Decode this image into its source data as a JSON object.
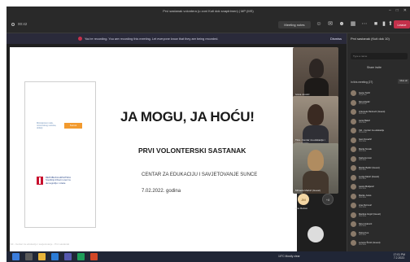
{
  "window": {
    "title": "Prvi sastanak volontera (u zoni Kuti dok snaptrimen) | MP (MS)"
  },
  "toolbar": {
    "timer": "00:42",
    "meeting_notes": "Meeting notes",
    "icons": [
      {
        "name": "people-icon",
        "label": "People"
      },
      {
        "name": "chat-icon",
        "label": "Chat"
      },
      {
        "name": "reactions-icon",
        "label": "React"
      },
      {
        "name": "rooms-icon",
        "label": "Rooms"
      },
      {
        "name": "more-icon",
        "label": "More"
      },
      {
        "name": "camera-icon",
        "label": "Camera"
      },
      {
        "name": "mic-icon",
        "label": "Mic"
      },
      {
        "name": "share-icon",
        "label": "Share"
      }
    ],
    "leave_label": "Leave"
  },
  "banner": {
    "text": "You're recording. You are recording this meeting. Let everyone know that they are being recorded.",
    "dismiss": "Dismiss"
  },
  "slide": {
    "logo_top_text": "Ministarstvo rada, mirovinskog sustava, obitelji",
    "logo_top_org": "Suncé",
    "logo_bottom_text": "REPUBLIKA HRVATSKA Središnji državni ured za demografiju i mlade",
    "title": "JA MOGU, JA HOĆU!",
    "subtitle": "PRVI VOLONTERSKI SASTANAK",
    "org": "CENTAR ZA EDUKACIJU I SAVJETOVANJE SUNCE",
    "date": "7.02.2022. godina",
    "caption": "Vid - Centar za edukaciju i savjetovanje - Prvi sastanak"
  },
  "tiles": [
    {
      "name": "Ivana Josotić"
    },
    {
      "name": "Tina - Centar za edukaciju i savjetovanje"
    },
    {
      "name": "Mihaela Markić (Guest)"
    }
  ],
  "avatars": [
    {
      "initials": "JM",
      "name": "Jana Markan"
    },
    {
      "initials": "+8",
      "name": ""
    }
  ],
  "panel": {
    "header": "Prvi sastanak (Kuti dok 10)",
    "search_placeholder": "Type a name",
    "share_label": "Share invite",
    "section": "In this meeting (27)",
    "mute_all": "Mute all",
    "participants": [
      {
        "name": "Ivana Točić",
        "role": "Organiser"
      },
      {
        "name": "Nina Radić",
        "role": "Presenter"
      },
      {
        "name": "Antonela Pavlović (Guest)",
        "role": "Attendee"
      },
      {
        "name": "Lana Bakić",
        "role": "Attendee"
      },
      {
        "name": "Vid - Centar za edukaciju",
        "role": "Presenter"
      },
      {
        "name": "Ivan Kovačić",
        "role": "Attendee"
      },
      {
        "name": "Marta Novak",
        "role": "Attendee"
      },
      {
        "name": "Karla Horvat",
        "role": "Attendee"
      },
      {
        "name": "Marko Babić (Guest)",
        "role": "Attendee"
      },
      {
        "name": "Lucija Marić (Guest)",
        "role": "Attendee"
      },
      {
        "name": "Laura Matijević",
        "role": "Attendee"
      },
      {
        "name": "Marko Juras",
        "role": "Attendee"
      },
      {
        "name": "Ana Petrović",
        "role": "Attendee"
      },
      {
        "name": "Martina Grgić (Guest)",
        "role": "Attendee"
      },
      {
        "name": "Nina Vuković",
        "role": "Attendee"
      },
      {
        "name": "Petra Kos",
        "role": "Attendee"
      },
      {
        "name": "Lorena Šimić (Guest)",
        "role": "Attendee"
      }
    ]
  },
  "taskbar": {
    "weather": "10°C Mostly clear",
    "time": "17:01 PM",
    "date": "7.2.2022."
  }
}
